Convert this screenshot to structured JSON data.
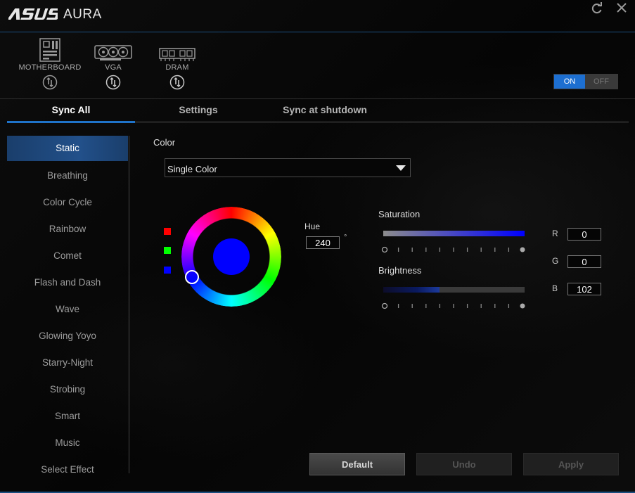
{
  "window": {
    "logo_text": "ASUS",
    "title": "AURA"
  },
  "devices": [
    {
      "label": "MOTHERBOARD",
      "icon": "motherboard-icon"
    },
    {
      "label": "VGA",
      "icon": "graphics-card-icon"
    },
    {
      "label": "DRAM",
      "icon": "memory-icon"
    }
  ],
  "power": {
    "on_label": "ON",
    "off_label": "OFF",
    "state": "on"
  },
  "tabs": [
    {
      "label": "Sync All",
      "active": true
    },
    {
      "label": "Settings",
      "active": false
    },
    {
      "label": "Sync at shutdown",
      "active": false
    }
  ],
  "effects": [
    {
      "label": "Static",
      "active": true
    },
    {
      "label": "Breathing"
    },
    {
      "label": "Color Cycle"
    },
    {
      "label": "Rainbow"
    },
    {
      "label": "Comet"
    },
    {
      "label": "Flash and Dash"
    },
    {
      "label": "Wave"
    },
    {
      "label": "Glowing Yoyo"
    },
    {
      "label": "Starry-Night"
    },
    {
      "label": "Strobing"
    },
    {
      "label": "Smart"
    },
    {
      "label": "Music"
    },
    {
      "label": "Select Effect"
    }
  ],
  "color": {
    "section_label": "Color",
    "mode_value": "Single Color",
    "swatches": [
      "#ff0000",
      "#00ff00",
      "#0000ff"
    ],
    "selected_color": "#0000ff"
  },
  "hue": {
    "label": "Hue",
    "value": "240",
    "unit": "°"
  },
  "saturation": {
    "label": "Saturation",
    "value_fraction": 1.0
  },
  "brightness": {
    "label": "Brightness",
    "value_fraction": 0.4
  },
  "rgb": {
    "r_label": "R",
    "r_value": "0",
    "g_label": "G",
    "g_value": "0",
    "b_label": "B",
    "b_value": "102"
  },
  "buttons": {
    "default_label": "Default",
    "undo_label": "Undo",
    "apply_label": "Apply"
  },
  "colors": {
    "accent": "#1f73c9",
    "on_active": "#1d6fd1",
    "border": "#1b4f80"
  }
}
